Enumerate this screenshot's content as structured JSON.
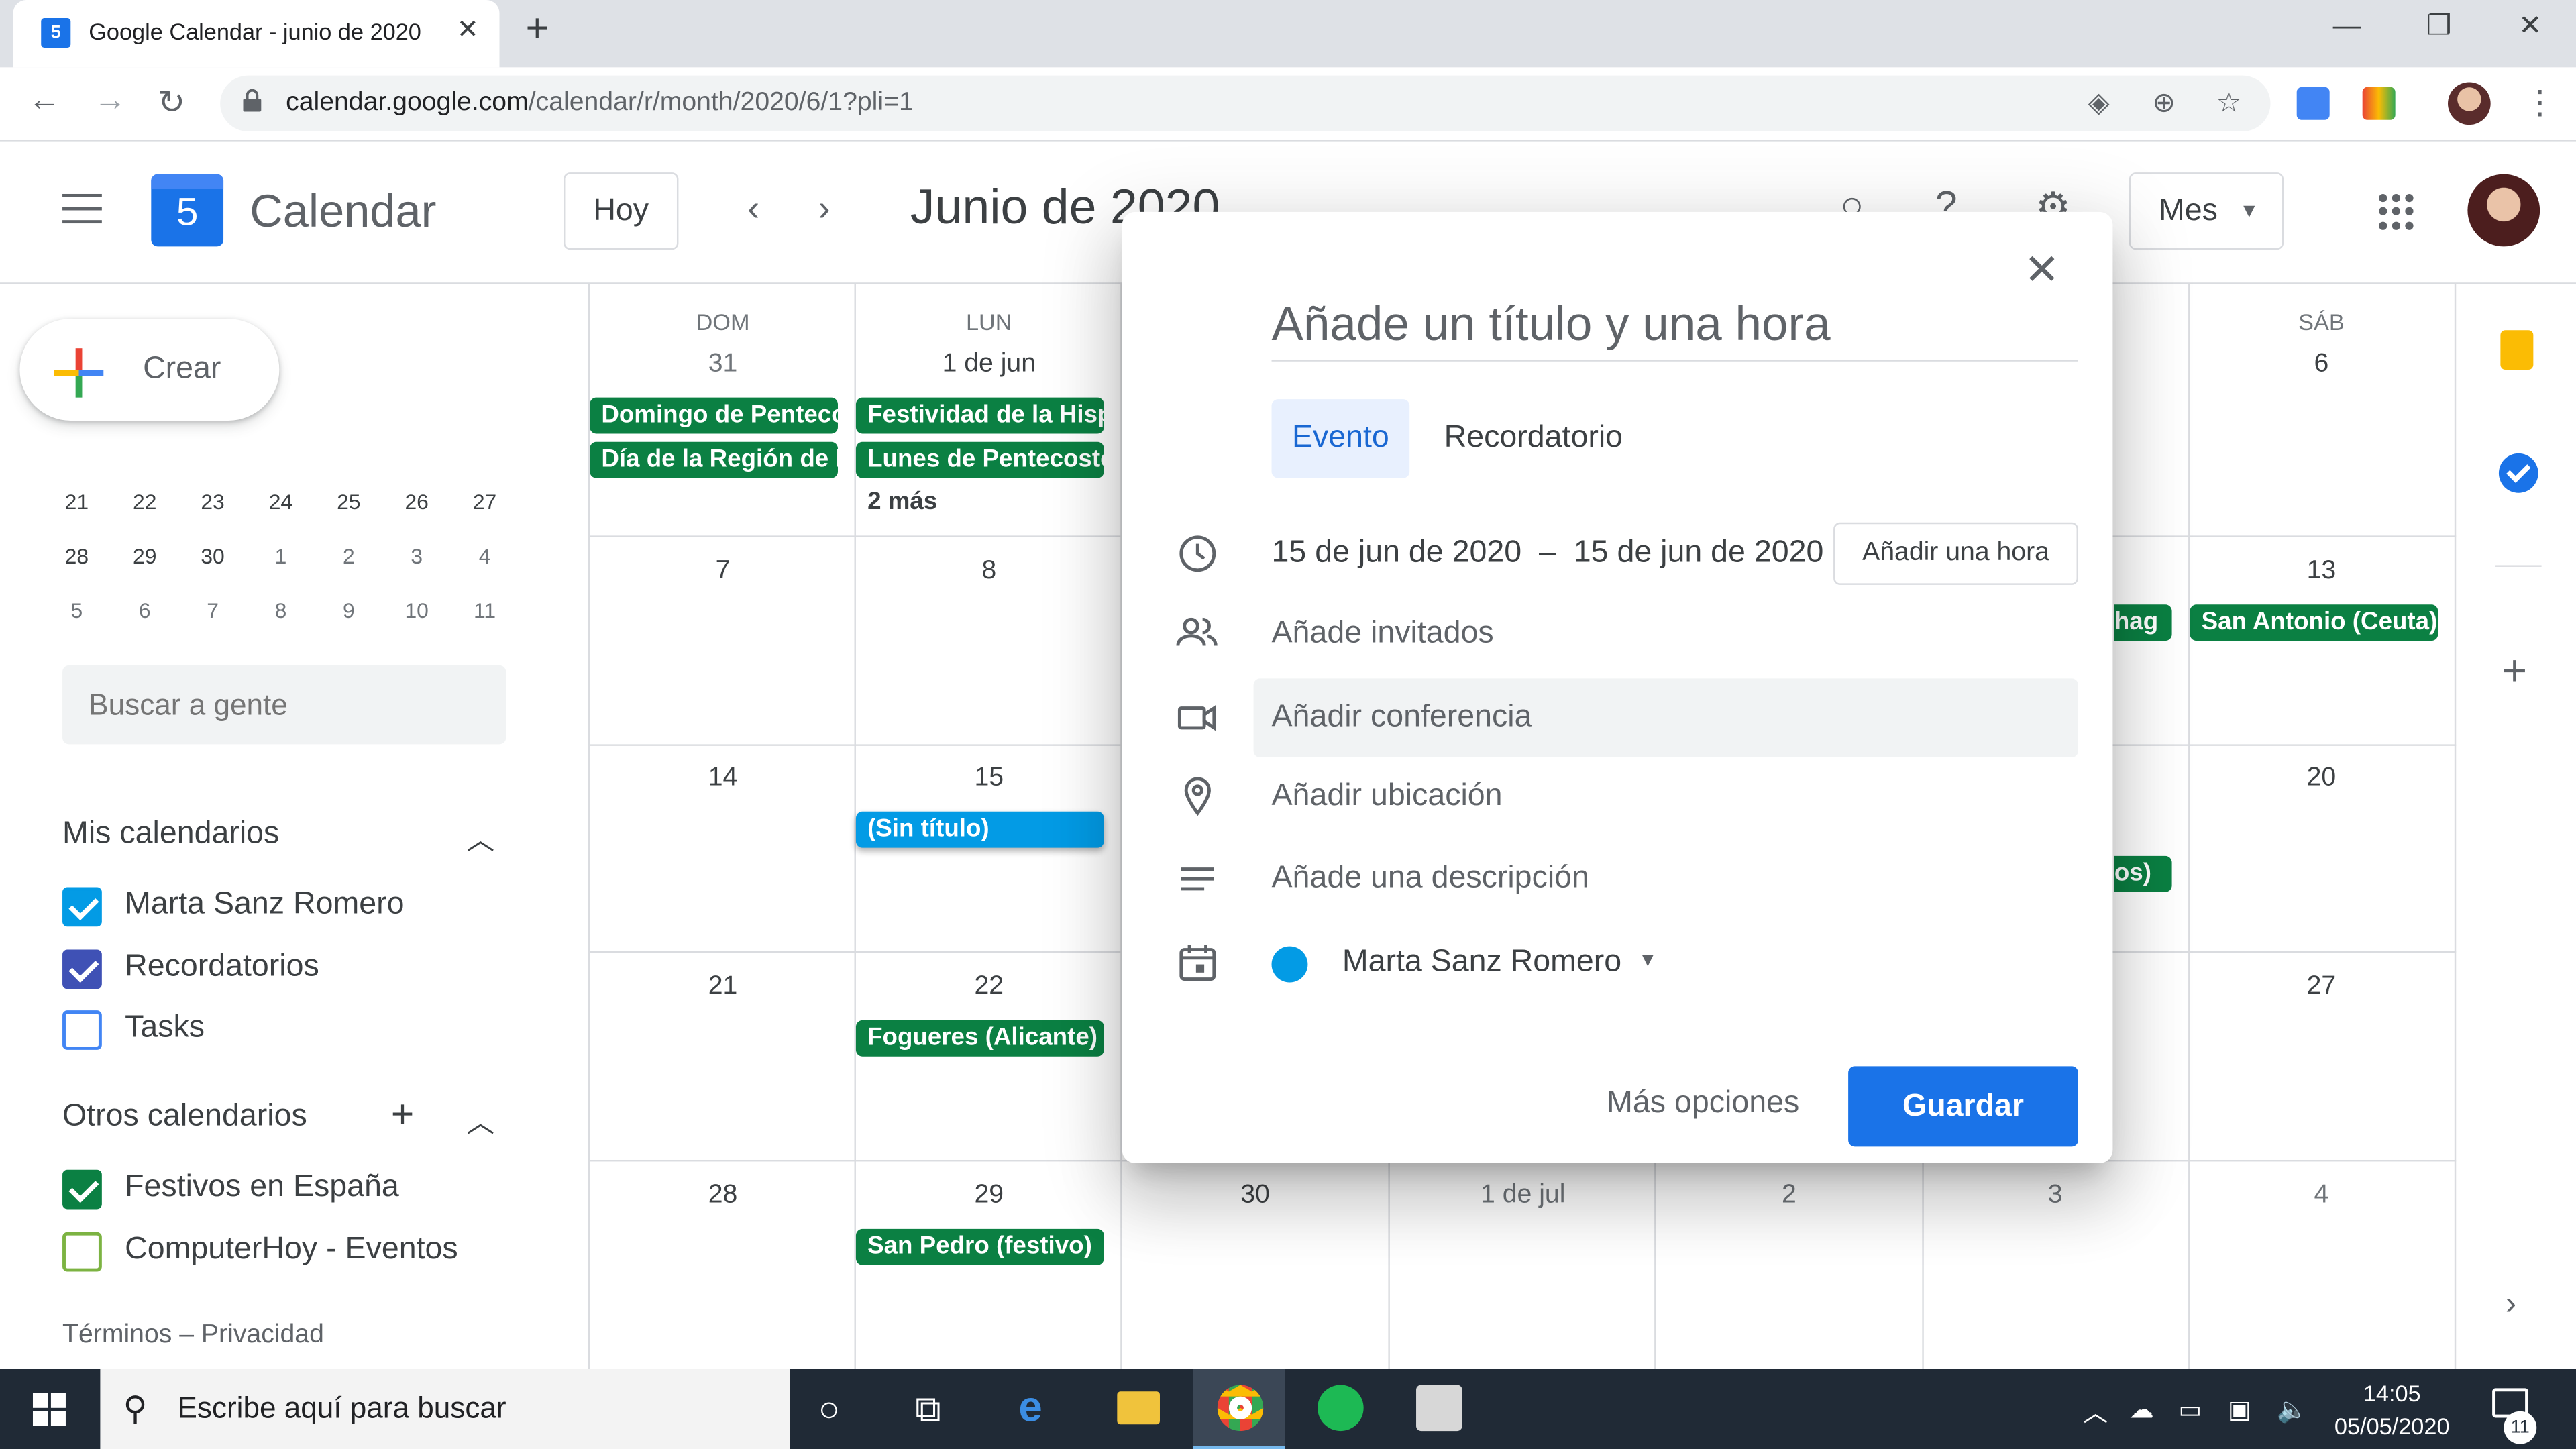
{
  "browser": {
    "tab_title": "Google Calendar - junio de 2020",
    "favicon_day": "5",
    "url_host": "calendar.google.com",
    "url_path": "/calendar/r/month/2020/6/1?pli=1"
  },
  "header": {
    "logo_day": "5",
    "app_name": "Calendar",
    "today_label": "Hoy",
    "month_title": "Junio de 2020",
    "view_label": "Mes"
  },
  "sidebar": {
    "create_label": "Crear",
    "minical_rows": [
      [
        "21",
        "22",
        "23",
        "24",
        "25",
        "26",
        "27"
      ],
      [
        "28",
        "29",
        "30",
        "1",
        "2",
        "3",
        "4"
      ],
      [
        "5",
        "6",
        "7",
        "8",
        "9",
        "10",
        "11"
      ]
    ],
    "search_placeholder": "Buscar a gente",
    "my_calendars_title": "Mis calendarios",
    "my_calendars": [
      {
        "name": "Marta Sanz Romero",
        "color": "#039be5",
        "checked": true
      },
      {
        "name": "Recordatorios",
        "color": "#3f51b5",
        "checked": true
      },
      {
        "name": "Tasks",
        "color": "#4285f4",
        "checked": false
      }
    ],
    "other_calendars_title": "Otros calendarios",
    "other_calendars": [
      {
        "name": "Festivos en España",
        "color": "#0b8043",
        "checked": true
      },
      {
        "name": "ComputerHoy - Eventos",
        "color": "#7cb342",
        "checked": false
      }
    ],
    "terms": "Términos – Privacidad"
  },
  "grid": {
    "dow": {
      "sun": "DOM",
      "mon": "LUN",
      "sat": "SÁB"
    },
    "week1": {
      "sun": "31",
      "mon": "1 de jun",
      "sat": "6"
    },
    "week2": {
      "sun": "7",
      "mon": "8",
      "sat": "13"
    },
    "week3": {
      "sun": "14",
      "mon": "15",
      "sat": "20"
    },
    "week4": {
      "sun": "21",
      "mon": "22",
      "sat": "27"
    },
    "week5": {
      "sun": "28",
      "mon": "29",
      "tue": "30",
      "wed": "1 de jul",
      "thu": "2",
      "fri": "3",
      "sat": "4"
    },
    "events": {
      "sun_w1_a": "Domingo de Pentecostés",
      "sun_w1_b": "Día de la Región de Murcia",
      "mon_w1_a": "Festividad de la Hispanidad",
      "mon_w1_b": "Lunes de Pentecostés",
      "mon_w1_more": "2 más",
      "fri_w2": "hag",
      "sat_w2": "San Antonio (Ceuta)",
      "mon_w3": "(Sin título)",
      "fri_w3": "os)",
      "mon_w4": "Fogueres (Alicante)",
      "mon_w5": "San Pedro (festivo)"
    },
    "event_color": "#0b8043",
    "draft_color": "#039be5"
  },
  "dialog": {
    "title_placeholder": "Añade un título y una hora",
    "tab_event": "Evento",
    "tab_reminder": "Recordatorio",
    "start_date": "15 de jun de 2020",
    "dash": "–",
    "end_date": "15 de jun de 2020",
    "add_time": "Añadir una hora",
    "guests": "Añade invitados",
    "conference": "Añadir conferencia",
    "location": "Añadir ubicación",
    "description": "Añade una descripción",
    "calendar": "Marta Sanz Romero",
    "more_options": "Más opciones",
    "save": "Guardar",
    "accent": "#1a73e8"
  },
  "taskbar": {
    "search_text": "Escribe aquí para buscar",
    "time": "14:05",
    "date": "05/05/2020",
    "notifications": "11"
  }
}
